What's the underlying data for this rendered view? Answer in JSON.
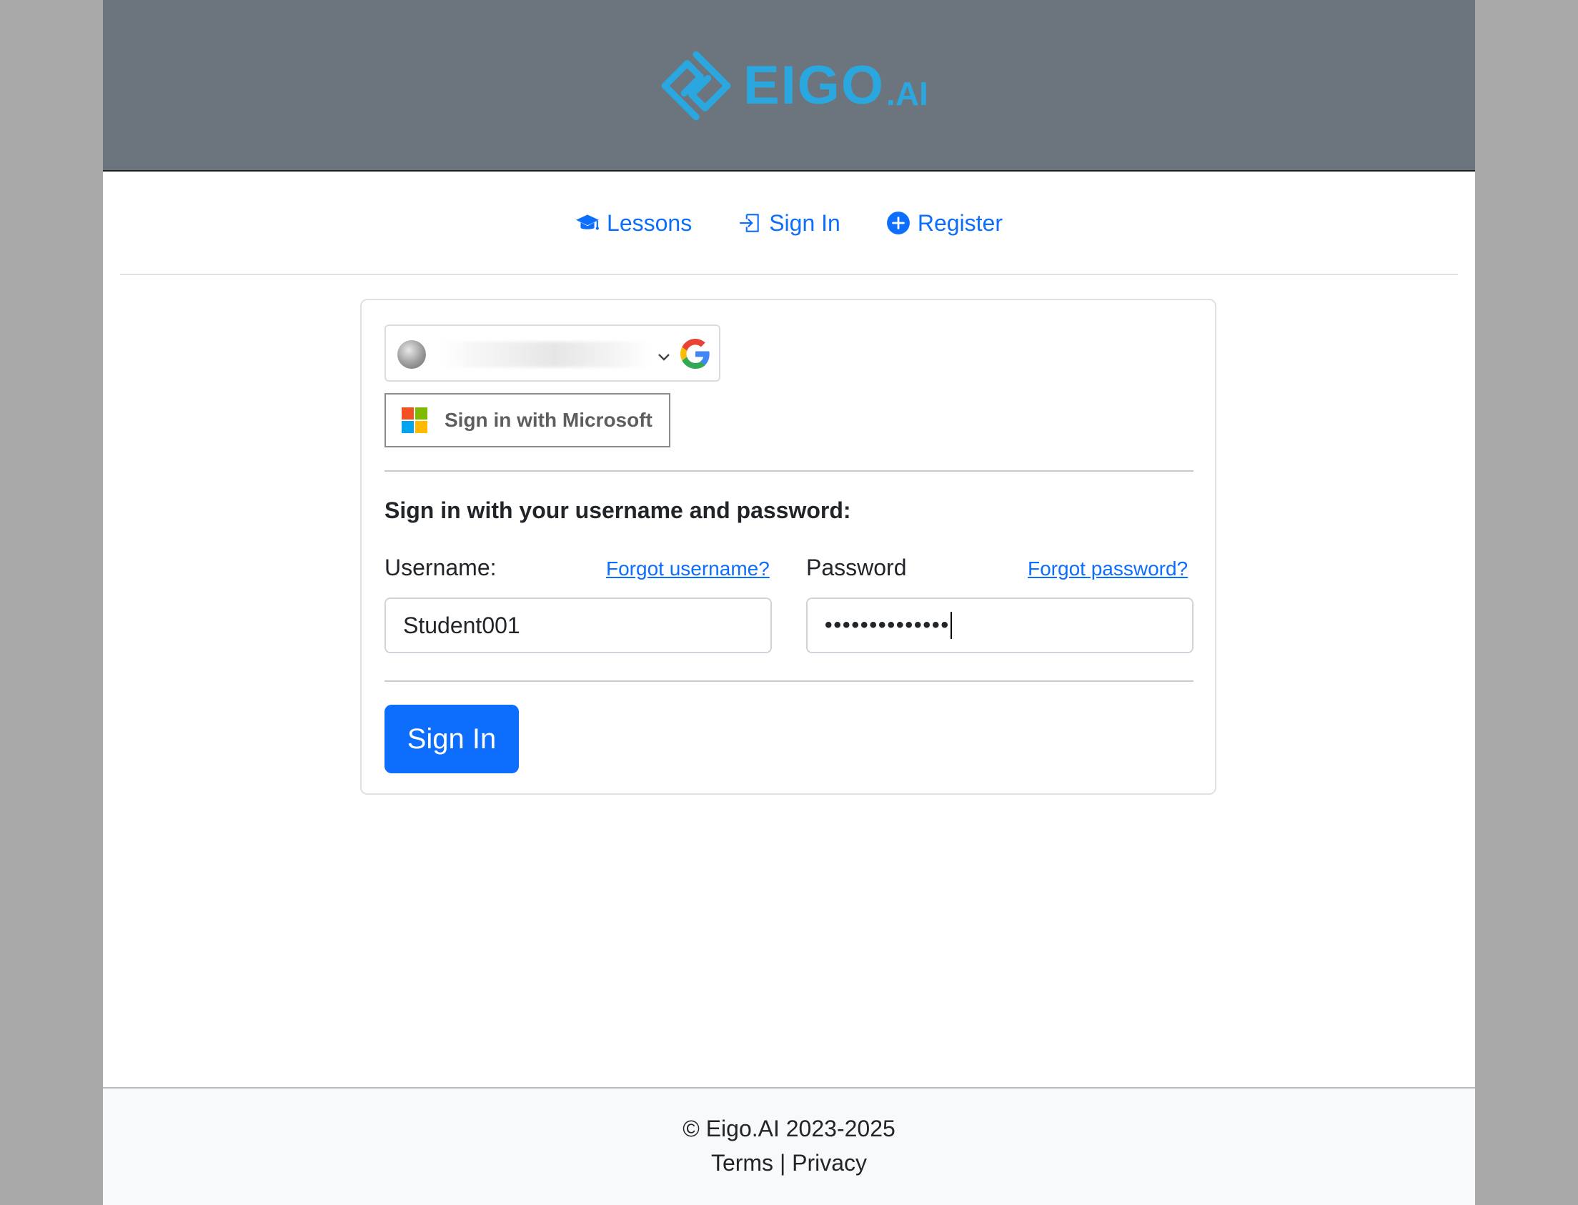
{
  "brand": {
    "logo_text": "EIGO",
    "logo_suffix": ".AI",
    "logo_color": "#2aa7df"
  },
  "nav": {
    "items": [
      {
        "label": "Lessons",
        "icon": "graduation-cap-icon"
      },
      {
        "label": "Sign In",
        "icon": "sign-in-icon"
      },
      {
        "label": "Register",
        "icon": "plus-circle-icon"
      }
    ],
    "link_color": "#0d6efd"
  },
  "sso": {
    "google_icon": "google-g-icon",
    "microsoft_label": "Sign in with Microsoft"
  },
  "form": {
    "title": "Sign in with your username and password:",
    "username_label": "Username:",
    "forgot_username": "Forgot username?",
    "username_value": "Student001",
    "password_label": "Password",
    "forgot_password": "Forgot password?",
    "password_masked": "••••••••••••••",
    "submit_label": "Sign In",
    "submit_color": "#0d6efd"
  },
  "footer": {
    "copyright": "© Eigo.AI 2023-2025",
    "terms": "Terms",
    "separator": "|",
    "privacy": "Privacy"
  }
}
